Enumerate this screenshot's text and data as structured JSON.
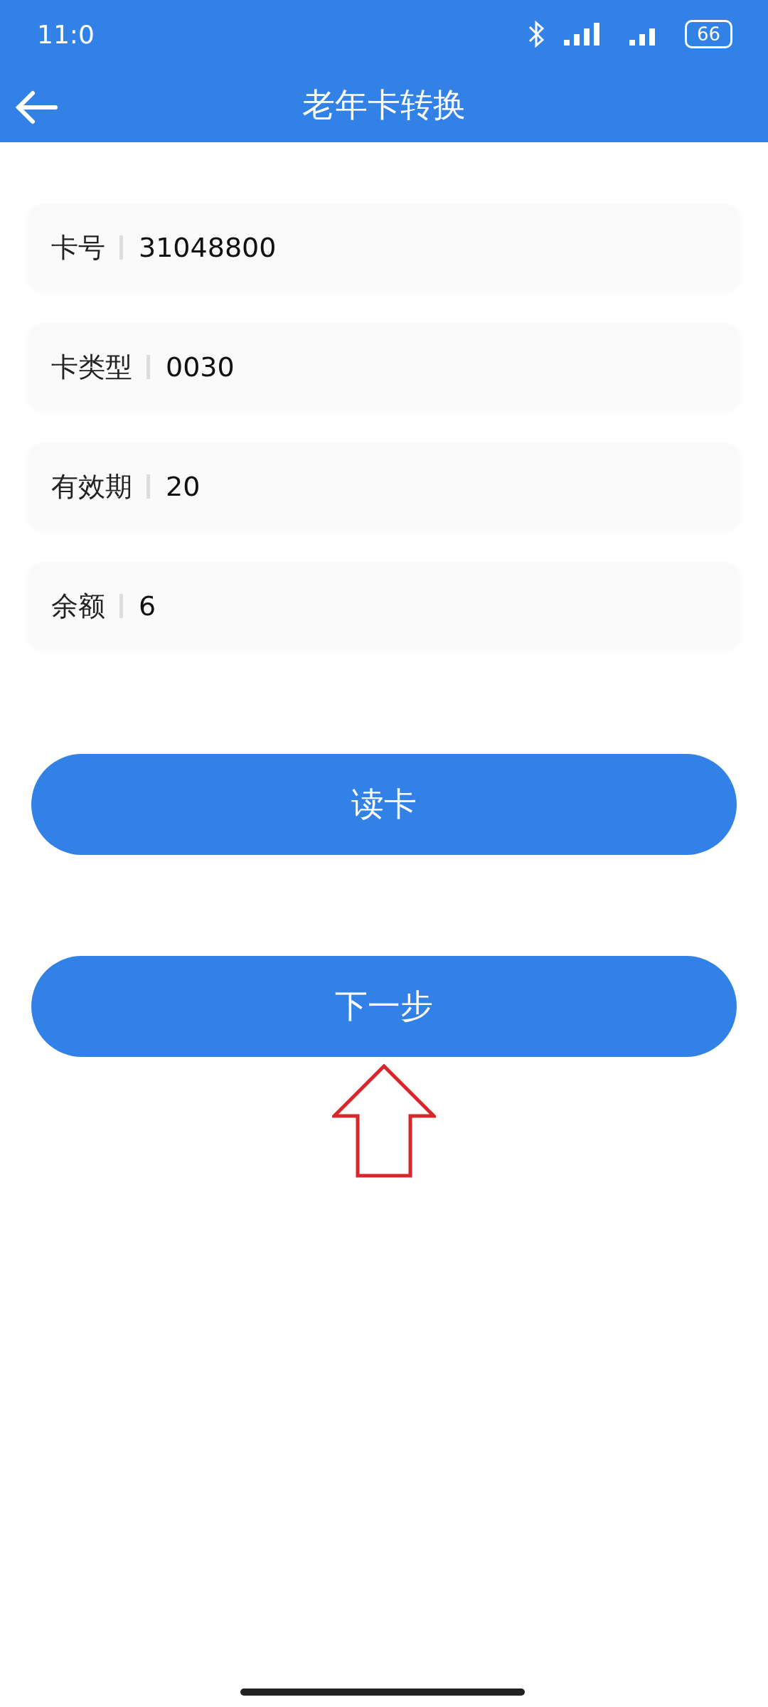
{
  "status_bar": {
    "time": "11:0",
    "battery": "66"
  },
  "header": {
    "title": "老年卡转换"
  },
  "fields": [
    {
      "label": "卡号",
      "value": "31048800"
    },
    {
      "label": "卡类型",
      "value": "0030"
    },
    {
      "label": "有效期",
      "value": "20"
    },
    {
      "label": "余额",
      "value": "6"
    }
  ],
  "buttons": [
    {
      "label": "读卡"
    },
    {
      "label": "下一步"
    }
  ]
}
